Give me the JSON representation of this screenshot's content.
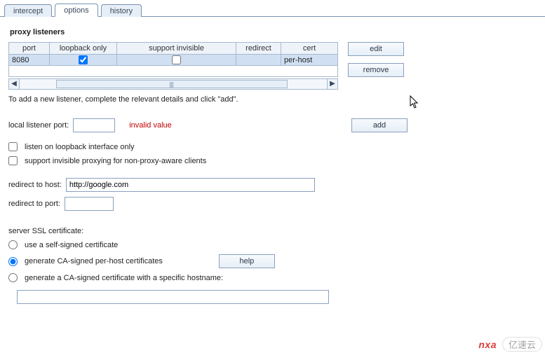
{
  "tabs": {
    "intercept": "intercept",
    "options": "options",
    "history": "history"
  },
  "panel": {
    "title": "proxy listeners"
  },
  "table": {
    "headers": {
      "port": "port",
      "loopback": "loopback only",
      "support": "support invisible",
      "redirect": "redirect",
      "cert": "cert"
    },
    "row0": {
      "port": "8080",
      "loopback": true,
      "support": false,
      "redirect": "",
      "cert": "per-host"
    }
  },
  "buttons": {
    "edit": "edit",
    "remove": "remove",
    "add": "add",
    "help": "help"
  },
  "hint": "To add a new listener, complete the relevant details and click \"add\".",
  "form": {
    "local_port_label": "local listener port:",
    "local_port_value": "",
    "invalid_msg": "invalid value",
    "loopback_label": "listen on loopback interface only",
    "support_label": "support invisible proxying for non-proxy-aware clients",
    "redirect_host_label": "redirect to host:",
    "redirect_host_value": "http://google.com",
    "redirect_port_label": "redirect to port:",
    "redirect_port_value": "",
    "ssl_title": "server SSL certificate:",
    "ssl_opt_self": "use a self-signed certificate",
    "ssl_opt_perhost": "generate CA-signed per-host certificates",
    "ssl_opt_specific": "generate a CA-signed certificate with a specific hostname:",
    "ssl_specific_value": ""
  },
  "watermark": {
    "brand": "nxa",
    "site": "亿速云"
  }
}
